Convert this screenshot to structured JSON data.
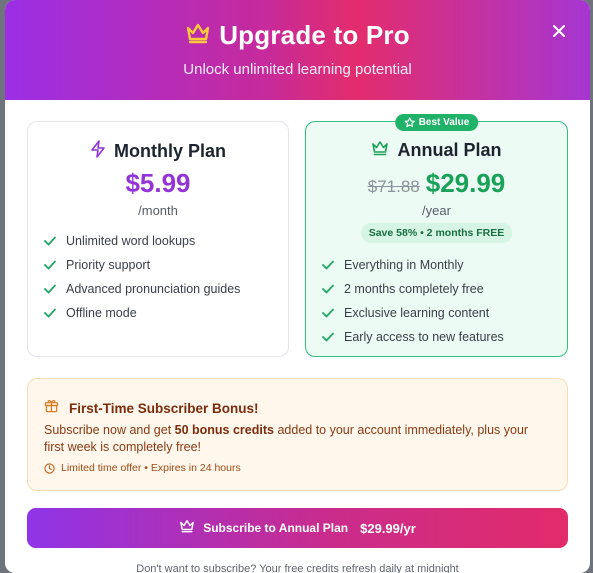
{
  "header": {
    "title": "Upgrade to Pro",
    "subtitle": "Unlock unlimited learning potential",
    "icon": "crown-icon",
    "close_icon": "close-icon"
  },
  "monthly": {
    "title": "Monthly Plan",
    "icon": "lightning-icon",
    "price": "$5.99",
    "period": "/month",
    "features": [
      "Unlimited word lookups",
      "Priority support",
      "Advanced pronunciation guides",
      "Offline mode"
    ]
  },
  "annual": {
    "badge": "Best Value",
    "badge_icon": "star-icon",
    "title": "Annual Plan",
    "icon": "crown-icon",
    "old_price": "$71.88",
    "price": "$29.99",
    "period": "/year",
    "save": "Save 58% • 2 months FREE",
    "features": [
      "Everything in Monthly",
      "2 months completely free",
      "Exclusive learning content",
      "Early access to new features"
    ]
  },
  "bonus": {
    "icon": "gift-icon",
    "title": "First-Time Subscriber Bonus!",
    "text_before": "Subscribe now and get ",
    "text_bold": "50 bonus credits",
    "text_after": " added to your account immediately, plus your first week is completely free!",
    "timer_icon": "clock-icon",
    "timer": "Limited time offer • Expires in 24 hours"
  },
  "cta": {
    "label": "Subscribe to Annual Plan",
    "price": "$29.99/yr",
    "icon": "crown-icon"
  },
  "footer": {
    "note": "Don't want to subscribe? Your free credits refresh daily at midnight"
  },
  "colors": {
    "monthly_accent": "#9433d6",
    "annual_accent": "#18a158",
    "header_gradient_start": "#9b2fe6",
    "header_gradient_mid": "#e32c6c",
    "bonus_bg": "#fff7ec"
  }
}
